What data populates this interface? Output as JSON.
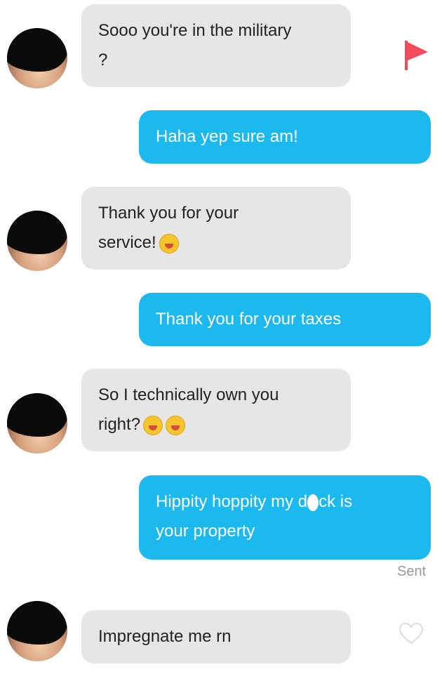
{
  "messages": [
    {
      "from": "them",
      "lines": [
        "Sooo you're in the military",
        "?"
      ]
    },
    {
      "from": "me",
      "lines": [
        "Haha yep sure am!"
      ]
    },
    {
      "from": "them",
      "lines": [
        "Thank you for your",
        "service!"
      ],
      "emoji": [
        "smiling-hug-emoji"
      ]
    },
    {
      "from": "me",
      "lines": [
        "Thank you for your taxes"
      ]
    },
    {
      "from": "them",
      "lines": [
        "So I technically own you",
        "right?"
      ],
      "emoji": [
        "tongue-out-emoji",
        "tongue-out-emoji"
      ]
    },
    {
      "from": "me",
      "lines_parts": {
        "line1_a": "Hippity hoppity my d",
        "line1_b": "ck is",
        "line2": "your property"
      }
    },
    {
      "from": "them",
      "lines": [
        "Impregnate me rn"
      ]
    }
  ],
  "status": {
    "sent_label": "Sent"
  },
  "icons": {
    "flag": "flag-icon",
    "heart": "heart-icon"
  },
  "colors": {
    "outgoing": "#1bb9ee",
    "incoming": "#e6e6e6",
    "flag": "#f24b5b"
  }
}
